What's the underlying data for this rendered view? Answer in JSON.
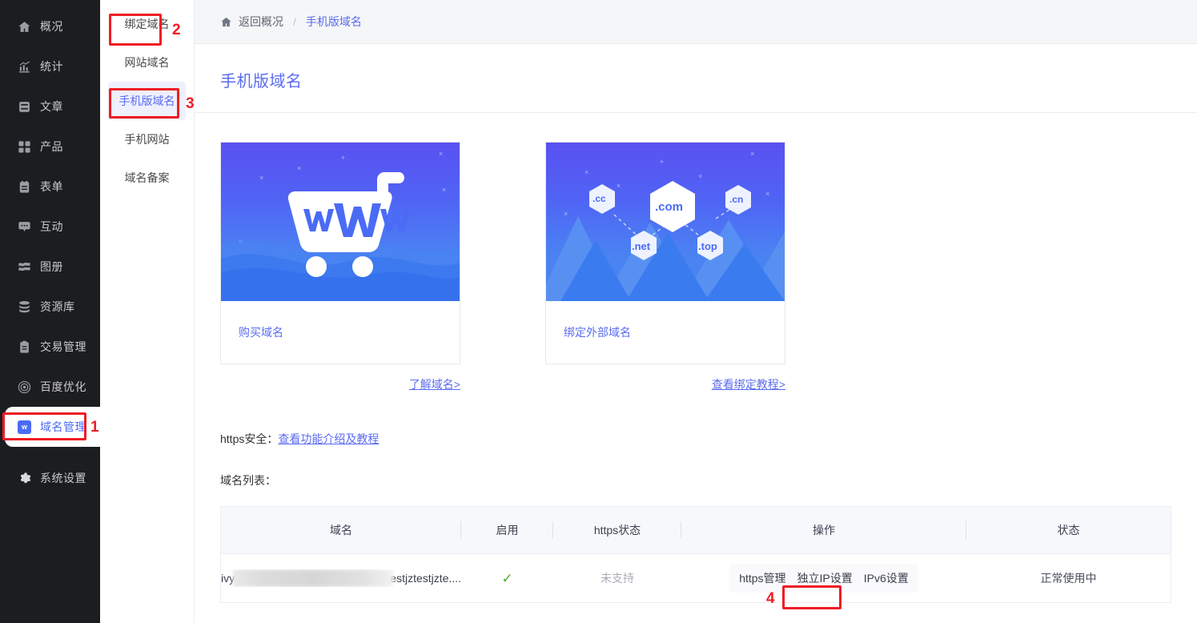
{
  "sidebar": {
    "items": [
      {
        "label": "概况",
        "icon": "home-icon",
        "active": false
      },
      {
        "label": "统计",
        "icon": "chart-icon",
        "active": false
      },
      {
        "label": "文章",
        "icon": "article-icon",
        "active": false
      },
      {
        "label": "产品",
        "icon": "grid-icon",
        "active": false
      },
      {
        "label": "表单",
        "icon": "form-icon",
        "active": false
      },
      {
        "label": "互动",
        "icon": "chat-icon",
        "active": false
      },
      {
        "label": "图册",
        "icon": "album-icon",
        "active": false
      },
      {
        "label": "资源库",
        "icon": "database-icon",
        "active": false
      },
      {
        "label": "交易管理",
        "icon": "clipboard-icon",
        "active": false
      },
      {
        "label": "百度优化",
        "icon": "spiral-icon",
        "active": false
      },
      {
        "label": "域名管理",
        "icon": "w-badge-icon",
        "active": true
      },
      {
        "label": "系统设置",
        "icon": "gear-icon",
        "active": false
      }
    ]
  },
  "subnav": {
    "items": [
      {
        "label": "绑定域名",
        "active": false
      },
      {
        "label": "网站域名",
        "active": false
      },
      {
        "label": "手机版域名",
        "active": true
      },
      {
        "label": "手机网站",
        "active": false
      },
      {
        "label": "域名备案",
        "active": false
      }
    ]
  },
  "breadcrumb": {
    "home_icon": "home-icon",
    "back_label": "返回概况",
    "separator": "/",
    "current_label": "手机版域名"
  },
  "page": {
    "title": "手机版域名"
  },
  "cards": [
    {
      "illustration": "shopping-cart-www",
      "title": "购买域名",
      "link": "了解域名>"
    },
    {
      "illustration": "domain-hexagons",
      "title": "绑定外部域名",
      "link": "查看绑定教程>",
      "hex_labels": [
        ".cc",
        ".com",
        ".cn",
        ".net",
        ".top"
      ]
    }
  ],
  "https_section": {
    "label": "https安全：",
    "link": "查看功能介绍及教程"
  },
  "list_section": {
    "label": "域名列表："
  },
  "table": {
    "columns": [
      "域名",
      "启用",
      "https状态",
      "操作",
      "状态"
    ],
    "rows": [
      {
        "domain_prefix": "ivy",
        "domain_suffix": "estjztestjzte....",
        "domain_redacted": true,
        "enabled": "✓",
        "https_status": "未支持",
        "actions": [
          "https管理",
          "独立IP设置",
          "IPv6设置"
        ],
        "state": "正常使用中"
      }
    ]
  },
  "annotations": [
    {
      "number": "1",
      "target": "sidebar-item-域名管理"
    },
    {
      "number": "2",
      "target": "subnav-item-绑定域名"
    },
    {
      "number": "3",
      "target": "subnav-item-手机版域名"
    },
    {
      "number": "4",
      "target": "https-manage-action"
    }
  ],
  "colors": {
    "accent": "#5b6cf0",
    "sidebar_bg": "#1c1d21",
    "annotation_red": "#ef1c24",
    "check_green": "#5aa832",
    "card_gradient_top": "#5a51f2",
    "card_gradient_bottom": "#4a86f0"
  }
}
